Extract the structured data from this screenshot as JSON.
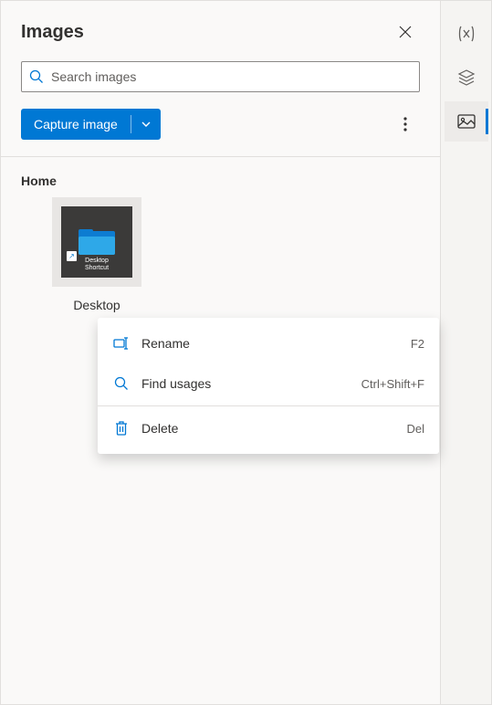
{
  "header": {
    "title": "Images"
  },
  "search": {
    "placeholder": "Search images"
  },
  "actions": {
    "capture_label": "Capture image"
  },
  "content": {
    "folder_label": "Home",
    "item": {
      "name": "Desktop",
      "thumb_text_line1": "Desktop",
      "thumb_text_line2": "Shortcut"
    }
  },
  "context_menu": {
    "items": [
      {
        "icon": "rename-icon",
        "label": "Rename",
        "shortcut": "F2"
      },
      {
        "icon": "search-icon",
        "label": "Find usages",
        "shortcut": "Ctrl+Shift+F"
      },
      {
        "icon": "trash-icon",
        "label": "Delete",
        "shortcut": "Del"
      }
    ]
  },
  "rail": {
    "items": [
      {
        "icon": "variables-icon"
      },
      {
        "icon": "layers-icon"
      },
      {
        "icon": "images-icon",
        "active": true
      }
    ]
  }
}
